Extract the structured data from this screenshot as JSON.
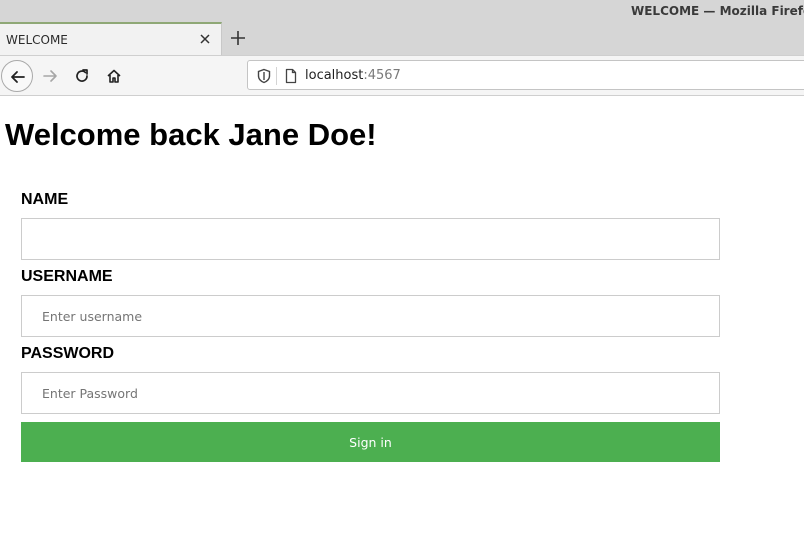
{
  "window": {
    "title": "WELCOME — Mozilla Firefox"
  },
  "tab": {
    "title": "WELCOME"
  },
  "address_bar": {
    "host": "localhost",
    "port": ":4567"
  },
  "page": {
    "heading": "Welcome back Jane Doe!",
    "form": {
      "name_label": "NAME",
      "name_value": "",
      "name_placeholder": "",
      "username_label": "USERNAME",
      "username_placeholder": "Enter username",
      "password_label": "PASSWORD",
      "password_placeholder": "Enter Password",
      "submit_label": "Sign in"
    }
  },
  "colors": {
    "submit_button": "#4caf50",
    "active_tab_accent": "#8fa876"
  },
  "icons": {
    "tab_close": "close-icon",
    "new_tab": "plus-icon",
    "back": "arrow-left-icon",
    "forward": "arrow-right-icon",
    "reload": "reload-icon",
    "home": "home-icon",
    "tracking": "shield-icon",
    "page": "page-icon"
  }
}
